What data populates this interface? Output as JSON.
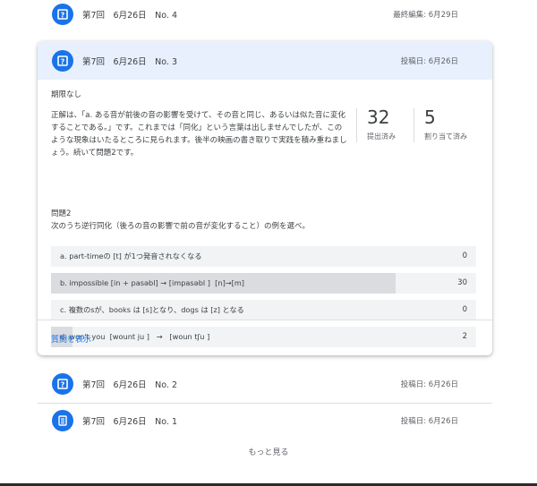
{
  "posts": [
    {
      "icon": "question-icon",
      "title": "第7回　6月26日　No. 4",
      "meta": "最終編集: 6月29日"
    },
    {
      "icon": "question-icon",
      "title": "第7回　6月26日　No. 3",
      "meta": "投稿日: 6月26日"
    },
    {
      "icon": "question-icon",
      "title": "第7回　6月26日　No. 2",
      "meta": "投稿日: 6月26日"
    },
    {
      "icon": "assignment-icon",
      "title": "第7回　6月26日　No. 1",
      "meta": "投稿日: 6月26日"
    }
  ],
  "expanded": {
    "deadline": "期限なし",
    "description": "正解は、「a. ある音が前後の音の影響を受けて、その音と同じ、あるいは似た音に変化することである。」です。これまでは「同化」という言葉は出しませんでしたが、このような現象はいたるところに見られます。後半の映画の書き取りで実践を積み重ねましょう。続いて問題2です。",
    "stats": {
      "submitted": {
        "value": "32",
        "label": "提出済み"
      },
      "assigned": {
        "value": "5",
        "label": "割り当て済み"
      }
    },
    "question_heading": "問題2",
    "question_text": "次のうち逆行同化（後ろの音の影響で前の音が変化すること）の例を選べ。",
    "options": [
      {
        "label": "a. part-timeの [t] が1つ発音されなくなる",
        "count": "0",
        "fraction": 0
      },
      {
        "label": "b. impossible [in + pasəbl] → [impasəbl ]  [n]→[m]",
        "count": "30",
        "fraction": 0.81
      },
      {
        "label": "c. 複数のsが、books は [s]となり、dogs は [z] となる",
        "count": "0",
        "fraction": 0
      },
      {
        "label": "d. won't you  [wount ju ]   →   [woun tʃu ]",
        "count": "2",
        "fraction": 0.05
      }
    ],
    "show_question_link": "質問を表示"
  },
  "more_label": "もっと見る",
  "colors": {
    "accent": "#1a73e8",
    "header_bg": "#e8f0fe",
    "option_bg": "#f1f3f4",
    "option_fill": "#dadce0"
  }
}
